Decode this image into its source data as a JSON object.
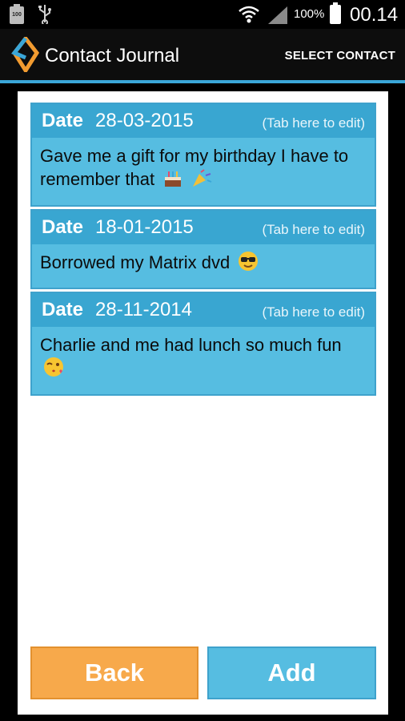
{
  "status_bar": {
    "battery_small_label": "100",
    "battery_percent": "100%",
    "time": "00.14",
    "icons": [
      "battery-icon",
      "usb-icon",
      "wifi-icon",
      "signal-icon",
      "battery-icon"
    ]
  },
  "action_bar": {
    "title": "Contact Journal",
    "select_contact": "SELECT CONTACT"
  },
  "colors": {
    "accent_blue": "#56bde1",
    "header_blue": "#39a6d1",
    "back_orange": "#f7a94b"
  },
  "entries": [
    {
      "date_label": "Date",
      "date": "28-03-2015",
      "edit_hint": "(Tab here to edit)",
      "text": "Gave me a gift for my birthday I have to remember that",
      "emojis": [
        "cake-emoji",
        "party-popper-emoji"
      ]
    },
    {
      "date_label": "Date",
      "date": "18-01-2015",
      "edit_hint": "(Tab here to edit)",
      "text": "Borrowed my Matrix dvd",
      "emojis": [
        "sunglasses-emoji"
      ]
    },
    {
      "date_label": "Date",
      "date": "28-11-2014",
      "edit_hint": "(Tab here to edit)",
      "text": "Charlie and me had lunch so much fun",
      "emojis": [
        "kissing-wink-emoji"
      ]
    }
  ],
  "buttons": {
    "back": "Back",
    "add": "Add"
  }
}
